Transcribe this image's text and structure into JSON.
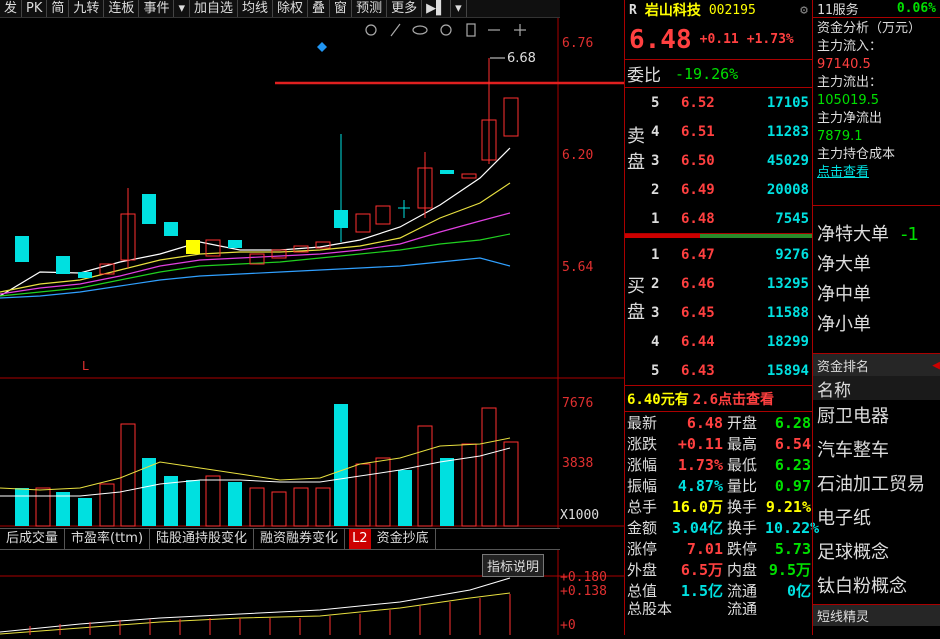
{
  "toolbar": [
    "发",
    "PK",
    "简",
    "九转",
    "连板",
    "事件",
    "▾",
    "加自选",
    "均线",
    "除权",
    "叠",
    "窗",
    "预测",
    "更多",
    "▶▌",
    "▾"
  ],
  "chart": {
    "price_labels": [
      "6.76",
      "6.20",
      "5.64"
    ],
    "high_marker": "6.68",
    "l_marker": "L",
    "vol_labels": [
      "7676",
      "3838",
      "X1000"
    ],
    "tabs": [
      "后成交量",
      "市盈率(ttm)",
      "陆股通持股变化",
      "融资融券变化",
      "L2",
      "资金抄底"
    ],
    "indicator_btn": "指标说明",
    "macd_labels": [
      "+0.180",
      "+0.138",
      "+0"
    ]
  },
  "quote": {
    "r_badge": "R",
    "name": "岩山科技",
    "code": "002195",
    "price": "6.48",
    "change": "+0.11",
    "change_pct": "+1.73%",
    "weibi_label": "委比",
    "weibi_value": "-19.26%",
    "sell_label": [
      "卖",
      "盘"
    ],
    "buy_label": [
      "买",
      "盘"
    ],
    "asks": [
      {
        "level": "5",
        "price": "6.52",
        "vol": "17105"
      },
      {
        "level": "4",
        "price": "6.51",
        "vol": "11283"
      },
      {
        "level": "3",
        "price": "6.50",
        "vol": "45029"
      },
      {
        "level": "2",
        "price": "6.49",
        "vol": "20008"
      },
      {
        "level": "1",
        "price": "6.48",
        "vol": "7545"
      }
    ],
    "bids": [
      {
        "level": "1",
        "price": "6.47",
        "vol": "9276"
      },
      {
        "level": "2",
        "price": "6.46",
        "vol": "13295"
      },
      {
        "level": "3",
        "price": "6.45",
        "vol": "11588"
      },
      {
        "level": "4",
        "price": "6.44",
        "vol": "18299"
      },
      {
        "level": "5",
        "price": "6.43",
        "vol": "15894"
      }
    ],
    "promo_a": "6.40元有",
    "promo_b": "2.6点击查看",
    "stats": [
      {
        "k1": "最新",
        "v1": "6.48",
        "k2": "开盘",
        "v2": "6.28"
      },
      {
        "k1": "涨跌",
        "v1": "+0.11",
        "k2": "最高",
        "v2": "6.54"
      },
      {
        "k1": "涨幅",
        "v1": "1.73%",
        "k2": "最低",
        "v2": "6.23"
      },
      {
        "k1": "振幅",
        "v1": "4.87%",
        "k2": "量比",
        "v2": "0.97"
      },
      {
        "k1": "总手",
        "v1": "16.0万",
        "k2": "换手",
        "v2": "9.21%"
      },
      {
        "k1": "金额",
        "v1": "3.04亿",
        "k2": "换手",
        "v2": "10.22%"
      },
      {
        "k1": "涨停",
        "v1": "7.01",
        "k2": "跌停",
        "v2": "5.73"
      },
      {
        "k1": "外盘",
        "v1": "6.5万",
        "k2": "内盘",
        "v2": "9.5万"
      },
      {
        "k1": "总值",
        "v1": "1.5亿",
        "k2": "流通",
        "v2": "0亿"
      },
      {
        "k1": "总股本",
        "v1": "",
        "k2": "流通",
        "v2": ""
      }
    ]
  },
  "side": {
    "service": "11服务",
    "service_pct": "0.06%",
    "fund_title": "资金分析（万元）",
    "inflow_label": "主力流入：",
    "inflow": "97140.5",
    "outflow_label": "主力流出：",
    "outflow": "105019.5",
    "net_label": "主力净流出",
    "net": "7879.1",
    "cost_label": "主力持仓成本",
    "cost_link": "点击查看",
    "flows": [
      "净特大单",
      "净大单",
      "净中单",
      "净小单"
    ],
    "flow_tail": "-1",
    "rank_title": "资金排名",
    "rank_header": "名称",
    "sectors": [
      "厨卫电器",
      "汽车整车",
      "石油加工贸易",
      "电子纸",
      "足球概念",
      "钛白粉概念"
    ],
    "short_title": "短线精灵"
  },
  "colors": {
    "up": "#ff4040",
    "down": "#00e0e0",
    "bg": "#000000"
  }
}
